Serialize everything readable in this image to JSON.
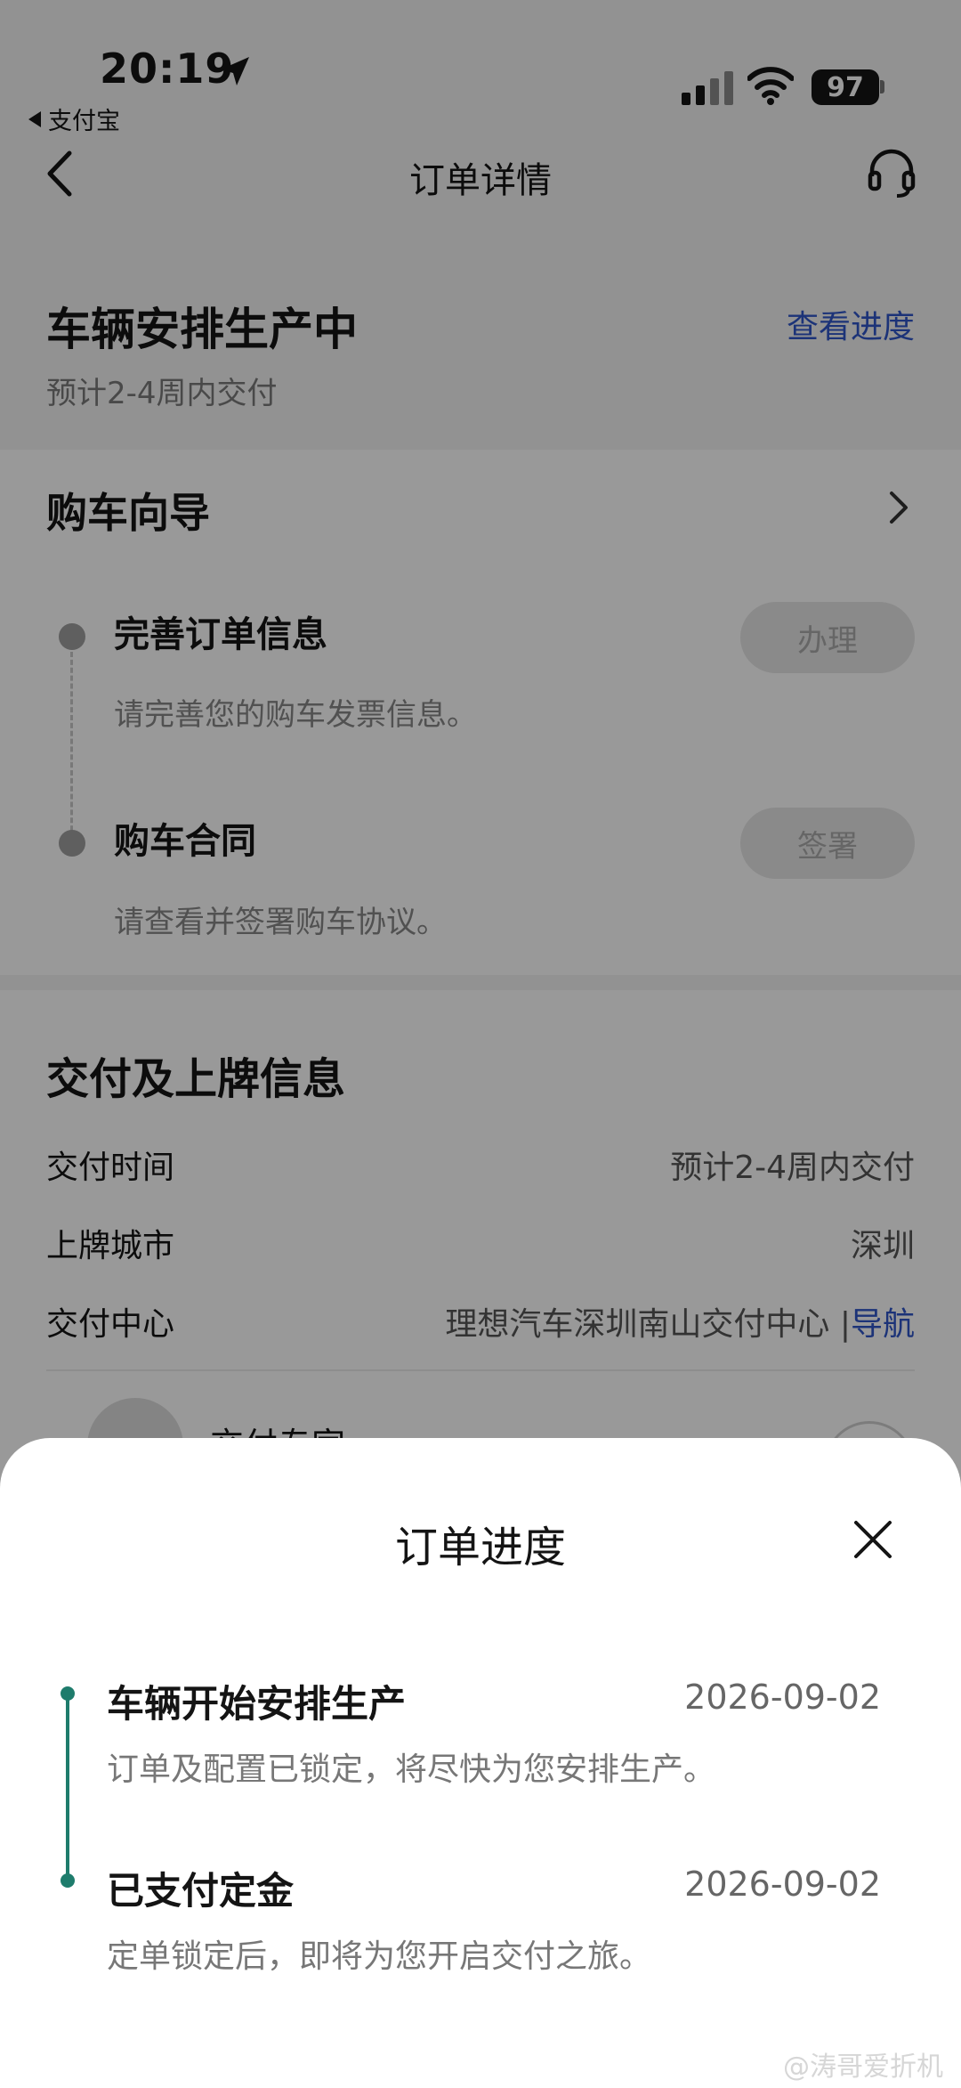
{
  "status_bar": {
    "time": "20:19",
    "back_app": "支付宝",
    "battery": "97"
  },
  "nav": {
    "title": "订单详情"
  },
  "status": {
    "title": "车辆安排生产中",
    "subtitle": "预计2-4周内交付",
    "link": "查看进度"
  },
  "guide": {
    "title": "购车向导",
    "steps": [
      {
        "title": "完善订单信息",
        "desc": "请完善您的购车发票信息。",
        "action": "办理"
      },
      {
        "title": "购车合同",
        "desc": "请查看并签署购车协议。",
        "action": "签署"
      }
    ]
  },
  "delivery": {
    "title": "交付及上牌信息",
    "rows": [
      {
        "label": "交付时间",
        "value": "预计2-4周内交付"
      },
      {
        "label": "上牌城市",
        "value": "深圳"
      },
      {
        "label": "交付中心",
        "value": "理想汽车深圳南山交付中心",
        "link": "导航"
      }
    ],
    "expert_label": "交付专家"
  },
  "sheet": {
    "title": "订单进度",
    "events": [
      {
        "title": "车辆开始安排生产",
        "date": "2026-09-02",
        "desc": "订单及配置已锁定，将尽快为您安排生产。"
      },
      {
        "title": "已支付定金",
        "date": "2026-09-02",
        "desc": "定单锁定后，即将为您开启交付之旅。"
      }
    ]
  },
  "watermark": "@涛哥爱折机",
  "colors": {
    "accent_link": "#2f56c8",
    "timeline": "#1e7c6c"
  }
}
